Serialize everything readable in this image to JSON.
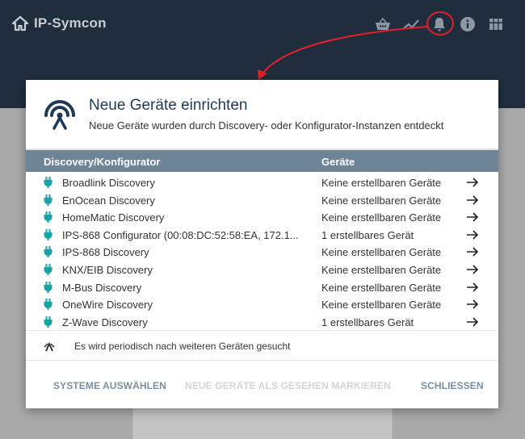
{
  "app": {
    "title": "IP-Symcon"
  },
  "colors": {
    "topbar": "#1f2d3d",
    "accent": "#1f3a57",
    "plug": "#18a3a6",
    "annotation": "#e0202a",
    "table_header": "#6e8497"
  },
  "toolbar": {
    "icons": [
      "basket-icon",
      "chart-icon",
      "bell-icon",
      "info-icon",
      "grid-icon"
    ]
  },
  "dialog": {
    "title": "Neue Geräte einrichten",
    "subtitle": "Neue Geräte wurden durch Discovery- oder Konfigurator-Instanzen entdeckt",
    "columns": [
      "Discovery/Konfigurator",
      "Geräte"
    ],
    "rows": [
      {
        "name": "Broadlink Discovery",
        "status": "Keine erstellbaren Geräte"
      },
      {
        "name": "EnOcean Discovery",
        "status": "Keine erstellbaren Geräte"
      },
      {
        "name": "HomeMatic Discovery",
        "status": "Keine erstellbaren Geräte"
      },
      {
        "name": "IPS-868 Configurator (00:08:DC:52:58:EA, 172.1...",
        "status": "1 erstellbares Gerät"
      },
      {
        "name": "IPS-868 Discovery",
        "status": "Keine erstellbaren Geräte"
      },
      {
        "name": "KNX/EIB Discovery",
        "status": "Keine erstellbaren Geräte"
      },
      {
        "name": "M-Bus Discovery",
        "status": "Keine erstellbaren Geräte"
      },
      {
        "name": "OneWire Discovery",
        "status": "Keine erstellbaren Geräte"
      },
      {
        "name": "Z-Wave Discovery",
        "status": "1 erstellbares Gerät"
      }
    ],
    "info": "Es wird periodisch nach weiteren Geräten gesucht",
    "buttons": {
      "select": "SYSTEME AUSWÄHLEN",
      "mark": "NEUE GERÄTE ALS GESEHEN MARKIEREN",
      "close": "SCHLIESSEN"
    }
  }
}
